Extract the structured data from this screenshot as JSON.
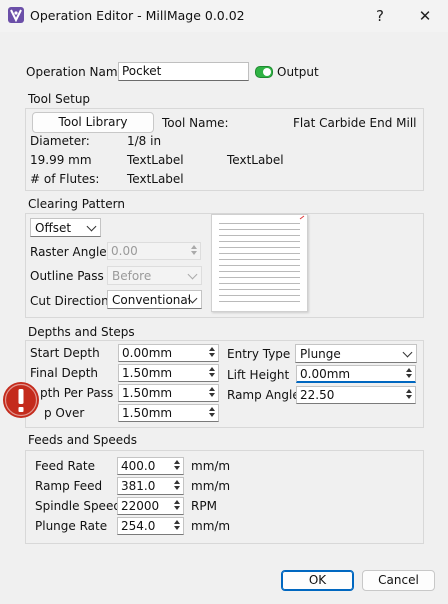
{
  "window": {
    "title": "Operation Editor - MillMage 0.0.02",
    "help": "?",
    "close": "✕"
  },
  "operation_name": {
    "label": "Operation Name",
    "value": "Pocket",
    "output_label": "Output",
    "output_on": true
  },
  "tool_setup": {
    "title": "Tool Setup",
    "tool_library_button": "Tool Library",
    "tool_name_label": "Tool Name:",
    "tool_name_value": "Flat Carbide End Mill",
    "diameter_label": "Diameter:",
    "diameter_value": "1/8 in",
    "diameter_mm": "19.99 mm",
    "text_label_1": "TextLabel",
    "text_label_2": "TextLabel",
    "flutes_label": "# of Flutes:",
    "flutes_value": "TextLabel"
  },
  "clearing_pattern": {
    "title": "Clearing Pattern",
    "pattern": "Offset",
    "raster_angle_label": "Raster Angle",
    "raster_angle_value": "0.00",
    "outline_pass_label": "Outline Pass",
    "outline_pass_value": "Before",
    "cut_direction_label": "Cut Direction",
    "cut_direction_value": "Conventional"
  },
  "depths_steps": {
    "title": "Depths and Steps",
    "start_depth_label": "Start Depth",
    "start_depth_value": "0.00mm",
    "final_depth_label": "Final Depth",
    "final_depth_value": "1.50mm",
    "depth_per_pass_label": "pth Per Pass",
    "depth_per_pass_value": "1.50mm",
    "step_over_label": "p Over",
    "step_over_value": "1.50mm",
    "entry_type_label": "Entry Type",
    "entry_type_value": "Plunge",
    "lift_height_label": "Lift Height",
    "lift_height_value": "0.00mm",
    "ramp_angle_label": "Ramp Angle",
    "ramp_angle_value": "22.50"
  },
  "feeds_speeds": {
    "title": "Feeds and Speeds",
    "feed_rate_label": "Feed Rate",
    "feed_rate_value": "400.0",
    "feed_rate_unit": "mm/m",
    "ramp_feed_label": "Ramp Feed",
    "ramp_feed_value": "381.0",
    "ramp_feed_unit": "mm/m",
    "spindle_speed_label": "Spindle Speed",
    "spindle_speed_value": "22000",
    "spindle_speed_unit": "RPM",
    "plunge_rate_label": "Plunge Rate",
    "plunge_rate_value": "254.0",
    "plunge_rate_unit": "mm/m"
  },
  "buttons": {
    "ok": "OK",
    "cancel": "Cancel"
  },
  "colors": {
    "toggle_on": "#2fb344",
    "accent": "#0067c0",
    "warning": "#c42b1c"
  }
}
